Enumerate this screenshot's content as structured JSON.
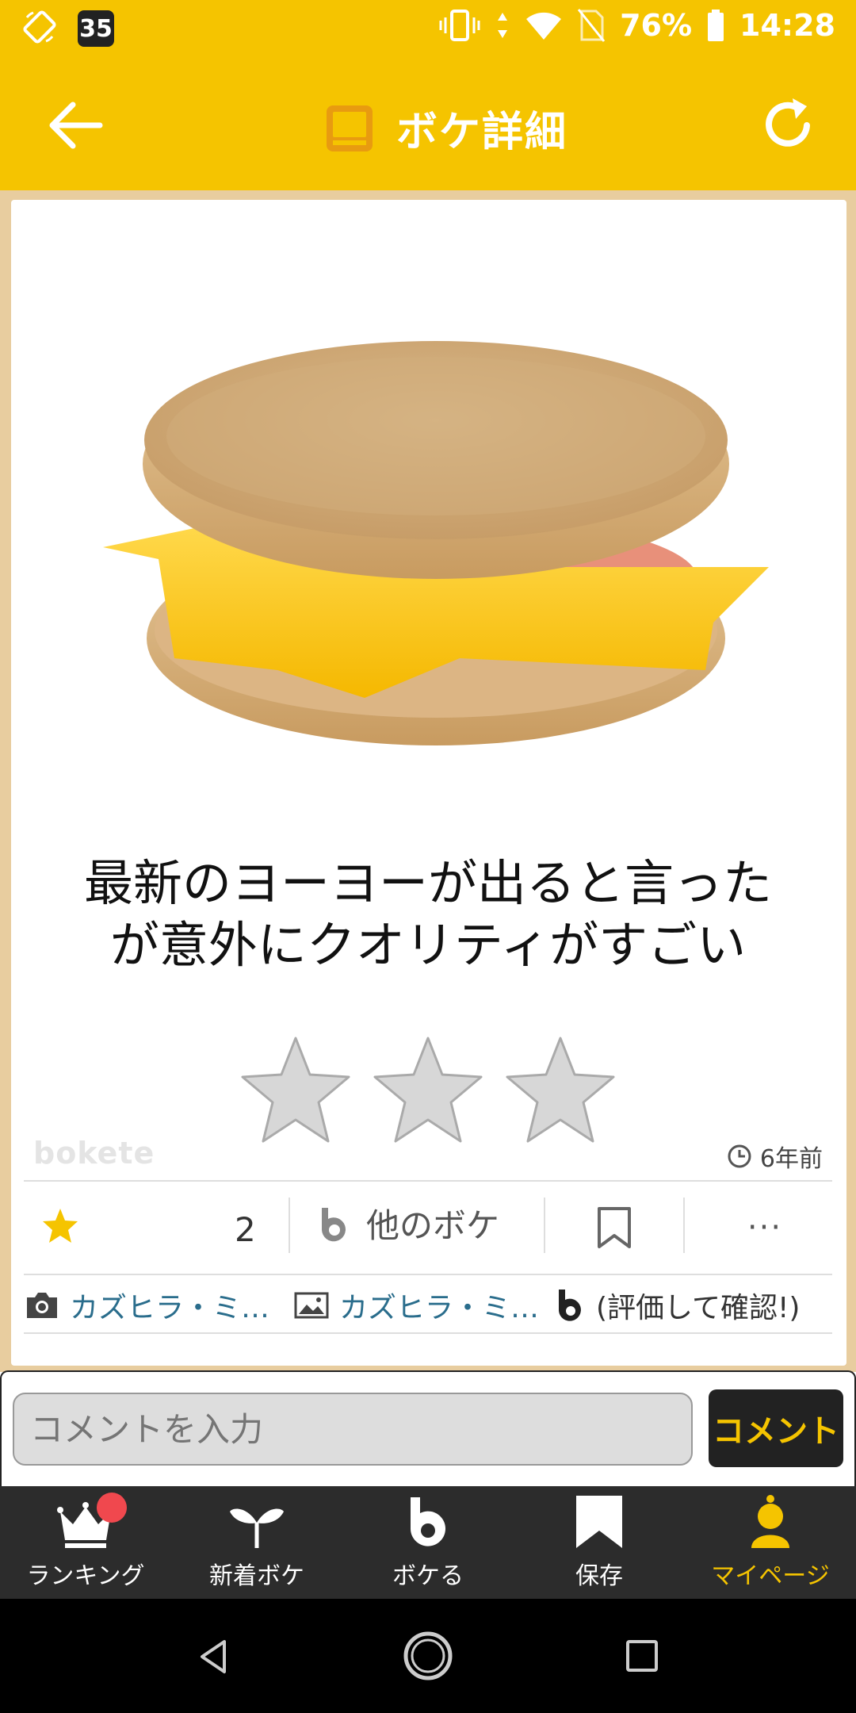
{
  "status_bar": {
    "notification_count": "35",
    "battery": "76%",
    "time": "14:28"
  },
  "header": {
    "title": "ボケ詳細"
  },
  "post": {
    "caption_line1": "最新のヨーヨーが出ると言った",
    "caption_line2": "が意外にクオリティがすごい",
    "watermark": "bokete",
    "time_ago": "6年前",
    "star_count": "2",
    "other_boke_label": "他のボケ",
    "more_label": "···",
    "photo_credit": "カズヒラ・ミ…",
    "image_credit": "カズヒラ・ミ…",
    "rater_note": "(評価して確認!)"
  },
  "comment": {
    "placeholder": "コメントを入力",
    "button_label": "コメント"
  },
  "bottom_nav": {
    "ranking": "ランキング",
    "new_boke": "新着ボケ",
    "boke": "ボケる",
    "save": "保存",
    "mypage": "マイページ"
  },
  "colors": {
    "brand_yellow": "#F5C400",
    "link_blue": "#2A6D8C",
    "nav_dark": "#2c2c2c",
    "badge_red": "#F0484E"
  }
}
